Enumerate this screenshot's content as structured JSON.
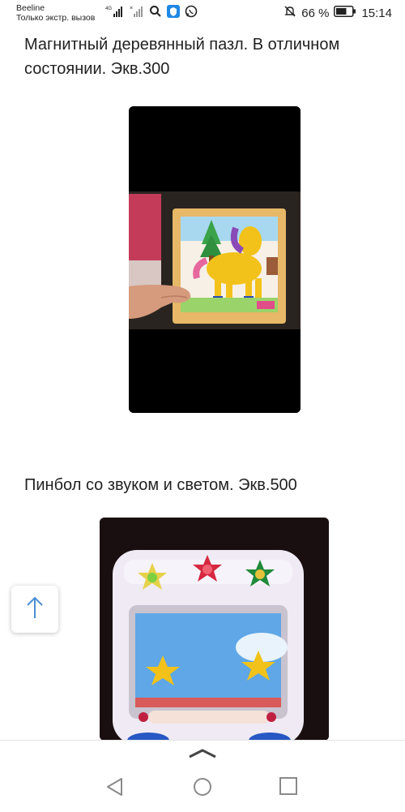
{
  "status_bar": {
    "carrier": "Beeline",
    "carrier_status": "Только экстр. вызов",
    "network_type": "4G",
    "battery_percent": "66 %",
    "battery_level": 0.66,
    "time": "15:14"
  },
  "posts": [
    {
      "text": "Магнитный деревянный пазл. В отличном",
      "text_line2": "состоянии. Экв.300"
    },
    {
      "text": "Пинбол со звуком и светом. Экв.500"
    }
  ],
  "scroll_top_button": {
    "icon": "arrow-up-icon"
  },
  "navigation": {
    "handle_icon": "chevron-up-icon",
    "back_icon": "back-triangle-icon",
    "home_icon": "home-circle-icon",
    "recents_icon": "recents-square-icon"
  },
  "colors": {
    "text": "#222222",
    "nav_icon": "#8a8a8a",
    "fab_arrow": "#4a8fd4"
  }
}
